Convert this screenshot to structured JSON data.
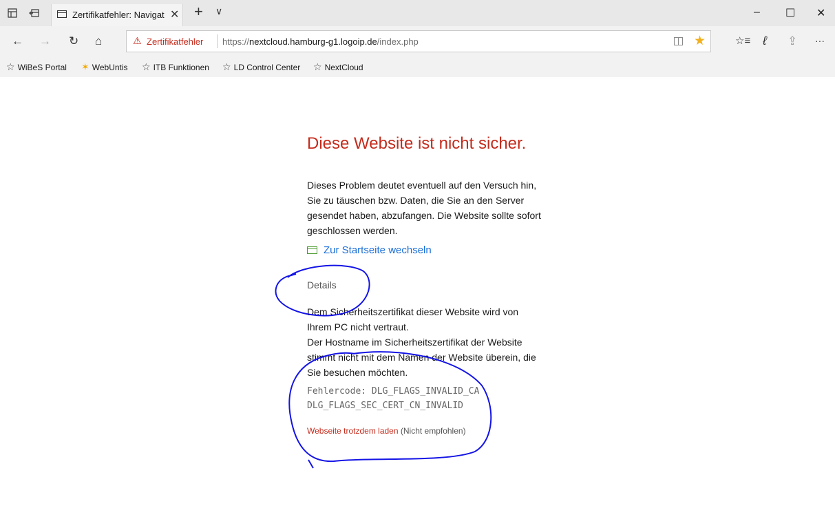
{
  "browser": {
    "tab": {
      "title": "Zertifikatfehler: Navigat",
      "close_glyph": "✕"
    },
    "new_tab_glyph": "+",
    "tab_list_glyph": "∨",
    "window_controls": {
      "minimize": "–",
      "maximize": "☐",
      "close": "✕"
    }
  },
  "nav": {
    "back_glyph": "←",
    "forward_glyph": "→",
    "refresh_glyph": "↻",
    "home_glyph": "⌂",
    "cert_warning_label": "Zertifikatfehler",
    "url": {
      "scheme": "https://",
      "host": "nextcloud.hamburg-g1.logoip.de",
      "path": "/index.php"
    },
    "star_glyph": "★",
    "favorites_hub_glyph": "☆≡",
    "notes_glyph": "ℓ",
    "share_glyph": "⇪",
    "more_glyph": "···"
  },
  "favorites": [
    {
      "label": "WiBeS Portal"
    },
    {
      "label": "WebUntis"
    },
    {
      "label": "ITB Funktionen"
    },
    {
      "label": "LD Control Center"
    },
    {
      "label": "NextCloud"
    }
  ],
  "page": {
    "heading": "Diese Website ist nicht sicher.",
    "paragraph": "Dieses Problem deutet eventuell auf den Versuch hin, Sie zu täuschen bzw. Daten, die Sie an den Server gesendet haben, abzufangen. Die Website sollte sofort geschlossen werden.",
    "home_link": "Zur Startseite wechseln",
    "details_label": "Details",
    "details_line1": "Dem Sicherheitszertifikat dieser Website wird von Ihrem PC nicht vertraut.",
    "details_line2": "Der Hostname im Sicherheitszertifikat der Website stimmt nicht mit dem Namen der Website überein, die Sie besuchen möchten.",
    "error_code_line1": "Fehlercode: DLG_FLAGS_INVALID_CA",
    "error_code_line2": "DLG_FLAGS_SEC_CERT_CN_INVALID",
    "load_link": "Webseite trotzdem laden",
    "load_note": "(Nicht empfohlen)"
  },
  "colors": {
    "annotation": "#1414e6",
    "warning_red": "#c42b1c",
    "link_blue": "#1a6ed8"
  }
}
